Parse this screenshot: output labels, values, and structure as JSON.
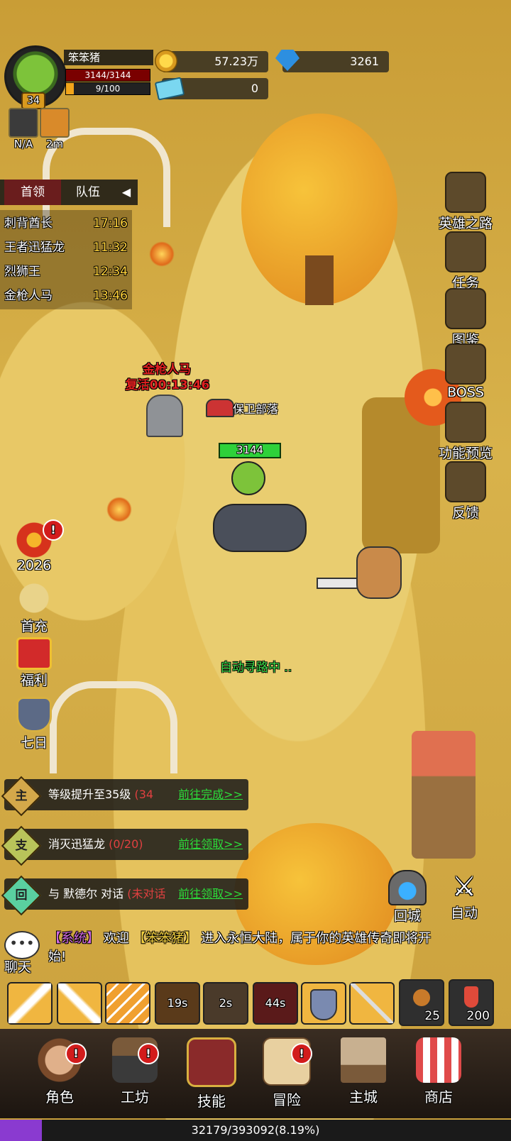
{
  "player": {
    "name": "笨笨猪",
    "level": "34",
    "hp": "3144/3144",
    "xp": "9/100",
    "xp_fraction": 0.09
  },
  "resources": {
    "gold": "57.23万",
    "gems": "3261",
    "tickets": "0"
  },
  "buffs": [
    {
      "label": "N/A",
      "icon": "crossed-swords-icon"
    },
    {
      "label": "2m",
      "icon": "rage-face-icon"
    }
  ],
  "boss_panel": {
    "tabs": [
      "首领",
      "队伍"
    ],
    "rows": [
      {
        "name": "刺背酋长",
        "time": "17:16"
      },
      {
        "name": "王者迅猛龙",
        "time": "11:32"
      },
      {
        "name": "烈狮王",
        "time": "12:34"
      },
      {
        "name": "金枪人马",
        "time": "13:46"
      }
    ]
  },
  "right_menu": [
    "英雄之路",
    "任务",
    "图鉴",
    "BOSS",
    "功能预览",
    "反馈"
  ],
  "left_menu": [
    {
      "label": "2026",
      "badge": "!"
    },
    {
      "label": "首充",
      "badge": ""
    },
    {
      "label": "福利",
      "badge": ""
    },
    {
      "label": "七日",
      "badge": ""
    }
  ],
  "world": {
    "boss_name": "金枪人马",
    "respawn": "复活00:13:46",
    "camp_label": "保卫部落",
    "player_hp": "3144",
    "auto_path": "自动寻路中 .."
  },
  "quests": [
    {
      "tag": "主",
      "text": "等级提升至35级",
      "progress": "(34",
      "action": "前往完成>>"
    },
    {
      "tag": "支",
      "text": "消灭迅猛龙",
      "progress": "(0/20)",
      "action": "前往领取>>"
    },
    {
      "tag": "回",
      "text": "与 默德尔 对话",
      "progress": "(未对话",
      "action": "前往领取>>"
    }
  ],
  "actions": {
    "return_city": "回城",
    "auto": "自动"
  },
  "chat": {
    "label": "聊天",
    "system_tag": "【系统】",
    "message_a": "欢迎",
    "player_tag": "【笨笨猪】",
    "message_b": "进入永恒大陆，属于你的英雄传奇即将开始!"
  },
  "skills": [
    {
      "cooldown": "",
      "icon": "blade-slash-icon"
    },
    {
      "cooldown": "",
      "icon": "sword-swing-icon"
    },
    {
      "cooldown": "",
      "icon": "triple-slash-icon"
    },
    {
      "cooldown": "19s",
      "icon": "burst-icon"
    },
    {
      "cooldown": "2s",
      "icon": "spin-icon"
    },
    {
      "cooldown": "44s",
      "icon": "helmet-icon"
    },
    {
      "cooldown": "",
      "icon": "shield-icon"
    },
    {
      "cooldown": "",
      "icon": "spear-icon"
    }
  ],
  "items": [
    {
      "count": "25",
      "icon": "orb-icon"
    },
    {
      "count": "200",
      "icon": "potion-icon"
    }
  ],
  "nav": [
    {
      "label": "角色",
      "badge": "!"
    },
    {
      "label": "工坊",
      "badge": "!"
    },
    {
      "label": "技能",
      "badge": ""
    },
    {
      "label": "冒险",
      "badge": "!"
    },
    {
      "label": "主城",
      "badge": ""
    },
    {
      "label": "商店",
      "badge": ""
    }
  ],
  "exp_bar": {
    "text": "32179/393092(8.19%)",
    "fraction": 0.0819
  }
}
